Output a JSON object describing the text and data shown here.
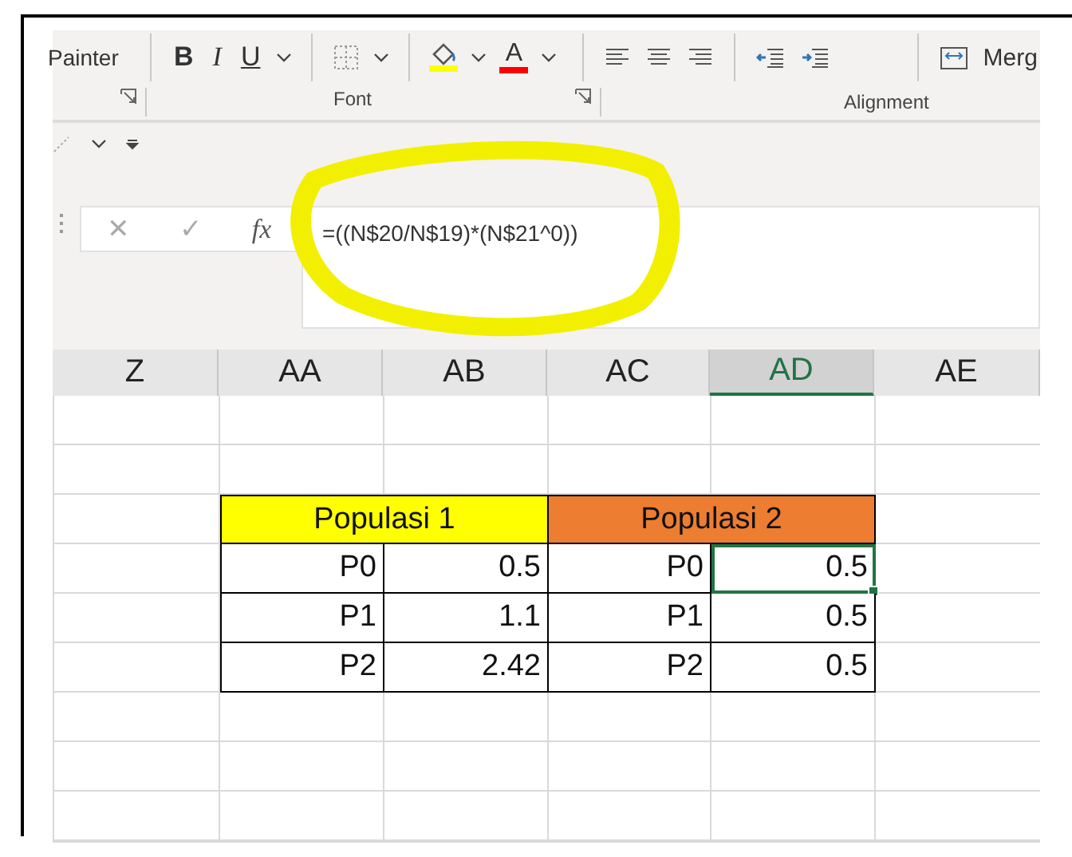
{
  "ribbon": {
    "clipboard_label": "Painter",
    "format_buttons": [
      {
        "label": "B",
        "kind": "bold"
      },
      {
        "label": "I",
        "kind": "italic"
      },
      {
        "label": "U",
        "kind": "underline"
      }
    ],
    "fill_color": {
      "color": "#ffff00"
    },
    "font_color": {
      "label": "A",
      "color": "#ff0000"
    },
    "merge_label": "Merg",
    "groups": [
      {
        "label": "Font"
      },
      {
        "label": "Alignment"
      }
    ]
  },
  "formula_bar": {
    "cancel": "✕",
    "enter": "✓",
    "function_label": "fx",
    "formula": "=((N$20/N$19)*(N$21^0))"
  },
  "annotation": {
    "kind": "ellipse"
  },
  "sheet": {
    "columns": [
      {
        "label": "Z",
        "selected": false
      },
      {
        "label": "AA",
        "selected": false
      },
      {
        "label": "AB",
        "selected": false
      },
      {
        "label": "AC",
        "selected": false
      },
      {
        "label": "AD",
        "selected": true
      },
      {
        "label": "AE",
        "selected": false
      }
    ],
    "table": {
      "headers": [
        {
          "text": "Populasi 1",
          "color": "#ffff00"
        },
        {
          "text": "Populasi 2",
          "color": "#ed7d31"
        }
      ],
      "rows": [
        {
          "cells": [
            {
              "text": "P0",
              "selected": false
            },
            {
              "text": "0.5",
              "selected": false
            },
            {
              "text": "P0",
              "selected": false
            },
            {
              "text": "0.5",
              "selected": true
            }
          ]
        },
        {
          "cells": [
            {
              "text": "P1",
              "selected": false
            },
            {
              "text": "1.1",
              "selected": false
            },
            {
              "text": "P1",
              "selected": false
            },
            {
              "text": "0.5",
              "selected": false
            }
          ]
        },
        {
          "cells": [
            {
              "text": "P2",
              "selected": false
            },
            {
              "text": "2.42",
              "selected": false
            },
            {
              "text": "P2",
              "selected": false
            },
            {
              "text": "0.5",
              "selected": false
            }
          ]
        }
      ]
    }
  }
}
